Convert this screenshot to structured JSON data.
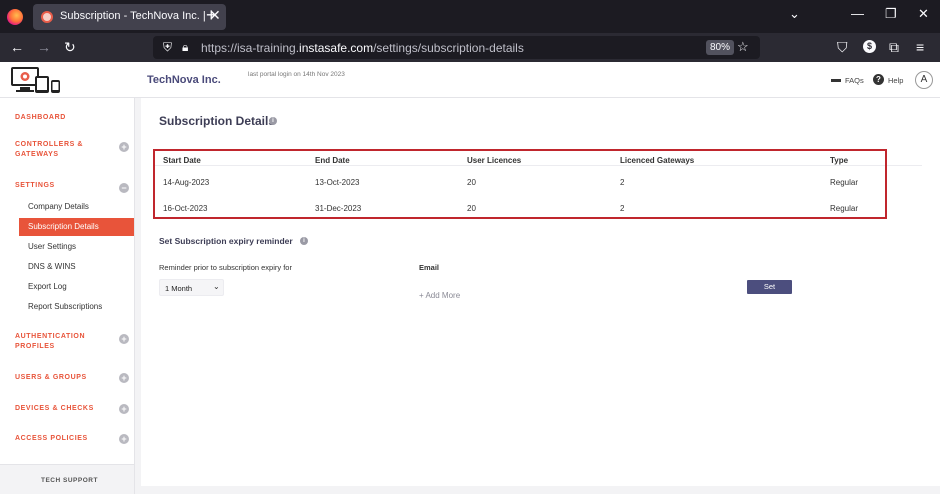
{
  "browser": {
    "tab_title": "Subscription - TechNova Inc. | Ins",
    "url_prefix": "https://isa-training.",
    "url_domain": "instasafe.com",
    "url_path": "/settings/subscription-details",
    "zoom": "80%"
  },
  "header": {
    "org_name": "TechNova Inc.",
    "last_login": "last portal login on 14th Nov 2023",
    "faqs": "FAQs",
    "help": "Help",
    "avatar_initial": "A"
  },
  "sidebar": {
    "dashboard": "DASHBOARD",
    "controllers_line1": "CONTROLLERS &",
    "controllers_line2": "GATEWAYS",
    "settings": "SETTINGS",
    "items": [
      "Company Details",
      "Subscription Details",
      "User Settings",
      "DNS & WINS",
      "Export Log",
      "Report Subscriptions"
    ],
    "auth_line1": "AUTHENTICATION",
    "auth_line2": "PROFILES",
    "users_groups": "USERS & GROUPS",
    "devices_checks": "DEVICES & CHECKS",
    "access_policies": "ACCESS POLICIES",
    "tech_support": "TECH SUPPORT"
  },
  "main": {
    "title": "Subscription Details",
    "table": {
      "headers": [
        "Start Date",
        "End Date",
        "User Licences",
        "Licenced Gateways",
        "Type"
      ],
      "rows": [
        [
          "14-Aug-2023",
          "13-Oct-2023",
          "20",
          "2",
          "Regular"
        ],
        [
          "16-Oct-2023",
          "31-Dec-2023",
          "20",
          "2",
          "Regular"
        ]
      ]
    },
    "reminder_title": "Set Subscription expiry reminder",
    "reminder_label": "Reminder prior to subscription expiry for",
    "reminder_value": "1 Month",
    "email_label": "Email",
    "add_more": "Add More",
    "set_button": "Set"
  }
}
